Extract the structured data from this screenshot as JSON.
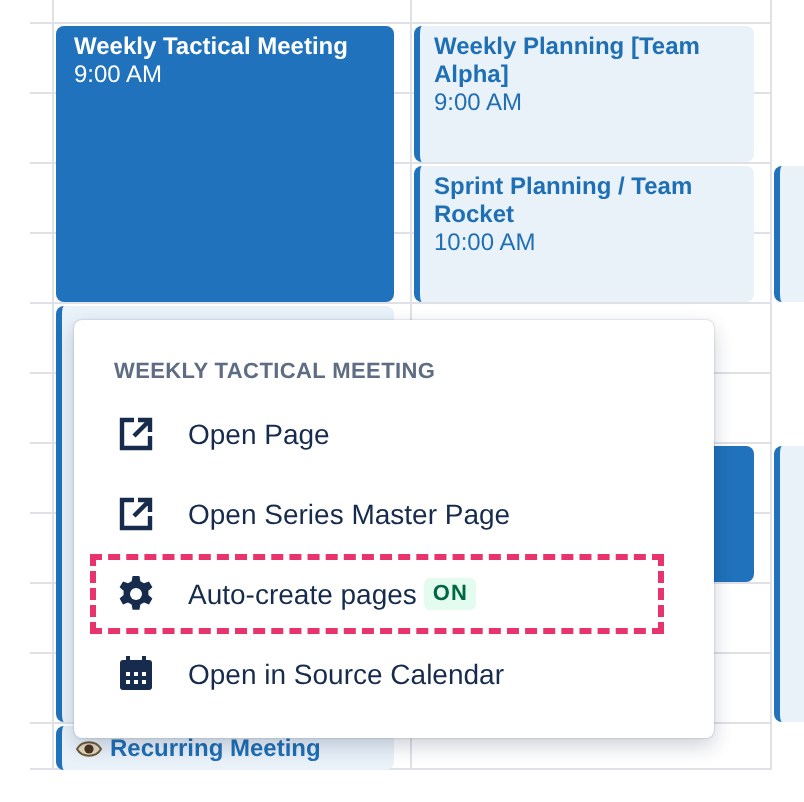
{
  "calendar": {
    "events": [
      {
        "kind": "solid",
        "title": "Weekly Tactical Meeting",
        "time": "9:00 AM"
      },
      {
        "kind": "light",
        "title": "Weekly Planning [Team Alpha]",
        "time": "9:00 AM"
      },
      {
        "kind": "light",
        "title": "Sprint Planning / Team Rocket",
        "time": "10:00 AM"
      },
      {
        "kind": "light"
      },
      {
        "kind": "solid"
      },
      {
        "kind": "light"
      },
      {
        "kind": "light"
      },
      {
        "kind": "recurring",
        "title": "Recurring Meeting"
      }
    ]
  },
  "menu": {
    "title": "WEEKLY TACTICAL MEETING",
    "items": [
      {
        "label": "Open Page",
        "highlighted": false
      },
      {
        "label": "Open Series Master Page",
        "highlighted": false
      },
      {
        "label": "Auto-create pages",
        "badge": "ON",
        "highlighted": true
      },
      {
        "label": "Open in Source Calendar",
        "highlighted": false
      }
    ]
  }
}
